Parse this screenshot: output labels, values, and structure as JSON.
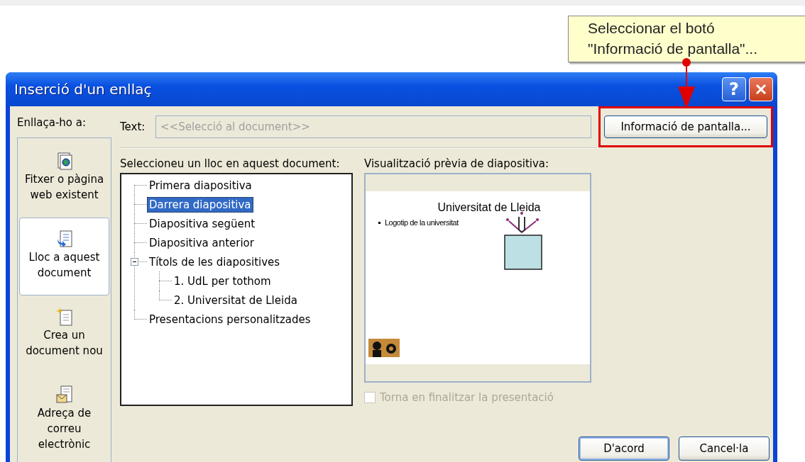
{
  "callout": {
    "lines": [
      "Seleccionar el botó",
      "\"Informació de pantalla\"..."
    ]
  },
  "window": {
    "title": "Inserció d'un enllaç",
    "help_button": "?"
  },
  "places": {
    "label": "Enllaça-ho a:",
    "items": [
      {
        "kind": "file",
        "label": "Fitxer o pàgina web existent",
        "selected": false
      },
      {
        "kind": "place",
        "label": "Lloc a aquest document",
        "selected": true
      },
      {
        "kind": "new",
        "label": "Crea un document nou",
        "selected": false
      },
      {
        "kind": "email",
        "label": "Adreça de correu electrònic",
        "selected": false
      }
    ]
  },
  "text_field": {
    "label": "Text:",
    "placeholder": "<<Selecció al document>>"
  },
  "screen_tip_button": {
    "label": "Informació de pantalla...",
    "highlighted": true
  },
  "tree": {
    "label": "Seleccioneu un lloc en aquest document:",
    "items": [
      {
        "label": "Primera diapositiva",
        "selected": false
      },
      {
        "label": "Darrera diapositiva",
        "selected": true
      },
      {
        "label": "Diapositiva següent",
        "selected": false
      },
      {
        "label": "Diapositiva anterior",
        "selected": false
      },
      {
        "label": "Títols de les diapositives",
        "selected": false,
        "expanded": true,
        "children": [
          {
            "label": "1. UdL per tothom",
            "selected": false
          },
          {
            "label": "2. Universitat de Lleida",
            "selected": false
          }
        ]
      },
      {
        "label": "Presentacions personalitzades",
        "selected": false
      }
    ]
  },
  "preview": {
    "label": "Visualització prèvia de diapositiva:",
    "slide": {
      "title": "Universitat de Lleida",
      "bullets": [
        "Logotip de la universitat"
      ]
    }
  },
  "end_checkbox": {
    "label": "Torna en finalitzar la presentació",
    "checked": false,
    "disabled": true
  },
  "buttons": [
    {
      "label": "D'acord",
      "default": true
    },
    {
      "label": "Cancel·la",
      "default": false
    }
  ]
}
